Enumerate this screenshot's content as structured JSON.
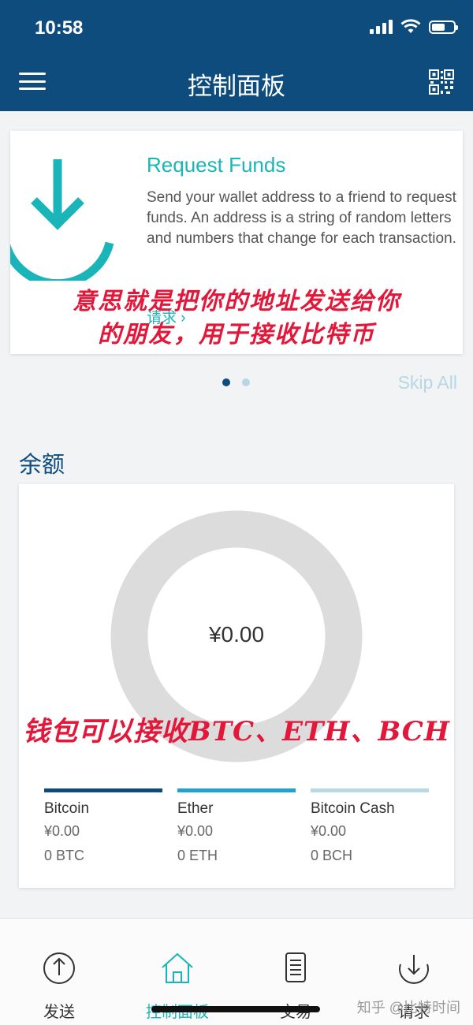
{
  "status_bar": {
    "time": "10:58"
  },
  "header": {
    "title": "控制面板"
  },
  "promo": {
    "title": "Request Funds",
    "description": "Send your wallet address to a friend to request funds. An address is a string of random letters and numbers that change for each transaction.",
    "link_label": "请求",
    "annotation_line1": "意思就是把你的地址发送给你",
    "annotation_line2": "的朋友，用于接收比特币",
    "accent_color": "#1ab5b8"
  },
  "carousel": {
    "page_count": 2,
    "active_page": 1,
    "skip_label": "Skip All"
  },
  "balance": {
    "section_title": "余额",
    "total": "¥0.00",
    "annotation": "钱包可以接收BTC、ETH、BCH",
    "coins": [
      {
        "name": "Bitcoin",
        "fiat": "¥0.00",
        "amount": "0 BTC",
        "color": "#0e4c7d"
      },
      {
        "name": "Ether",
        "fiat": "¥0.00",
        "amount": "0 ETH",
        "color": "#1fa3d0"
      },
      {
        "name": "Bitcoin Cash",
        "fiat": "¥0.00",
        "amount": "0 BCH",
        "color": "#b7d9e4"
      }
    ]
  },
  "bottom_nav": {
    "items": [
      {
        "label": "发送",
        "icon": "send-icon"
      },
      {
        "label": "控制面板",
        "icon": "home-icon",
        "active": true
      },
      {
        "label": "交易",
        "icon": "transactions-icon"
      },
      {
        "label": "请求",
        "icon": "request-icon"
      }
    ]
  },
  "watermark": "知乎 @比特时间",
  "colors": {
    "header_bg": "#0e4c7d",
    "accent": "#1ab5b8",
    "annotation": "#e3173a"
  }
}
